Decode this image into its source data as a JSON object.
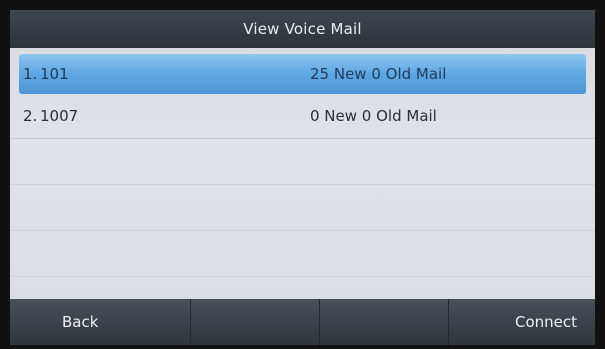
{
  "window": {
    "title": "View Voice Mail"
  },
  "voicemail": {
    "rows": [
      {
        "index": "1.",
        "account": "101",
        "status": "25 New 0 Old Mail",
        "selected": true
      },
      {
        "index": "2.",
        "account": "1007",
        "status": "0 New 0 Old Mail",
        "selected": false
      }
    ]
  },
  "softkeys": {
    "back": "Back",
    "key2": "",
    "key3": "",
    "connect": "Connect"
  },
  "colors": {
    "title_bar": "#363b42",
    "selection": "#5ea7e2",
    "softkey_bar": "#3b4047",
    "background": "#dcdfe3"
  }
}
